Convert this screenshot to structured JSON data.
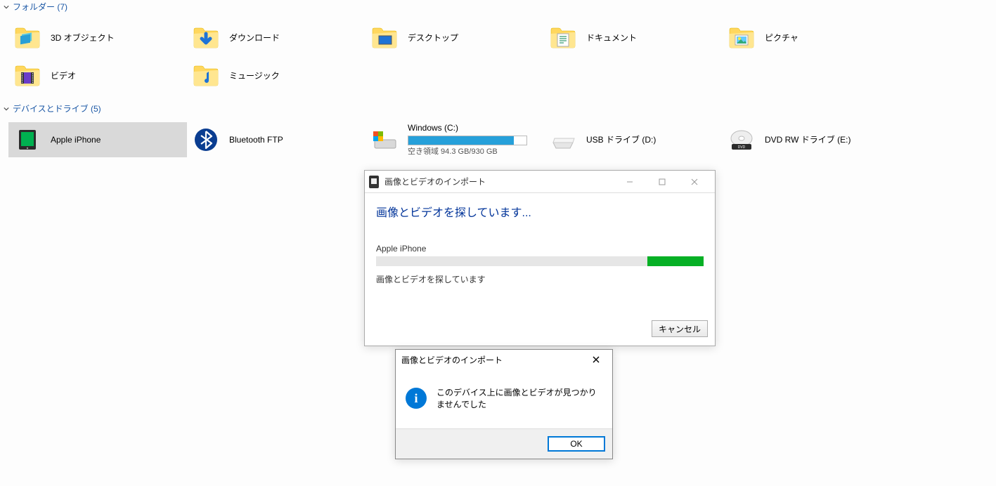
{
  "sections": {
    "folders": {
      "title": "フォルダー (7)",
      "items": [
        {
          "label": "3D オブジェクト",
          "icon": "3d"
        },
        {
          "label": "ダウンロード",
          "icon": "download"
        },
        {
          "label": "デスクトップ",
          "icon": "desktop"
        },
        {
          "label": "ドキュメント",
          "icon": "document"
        },
        {
          "label": "ピクチャ",
          "icon": "picture"
        },
        {
          "label": "ビデオ",
          "icon": "video"
        },
        {
          "label": "ミュージック",
          "icon": "music"
        }
      ]
    },
    "drives": {
      "title": "デバイスとドライブ (5)",
      "items": [
        {
          "label": "Apple iPhone",
          "icon": "phone",
          "selected": true
        },
        {
          "label": "Bluetooth FTP",
          "icon": "bluetooth"
        },
        {
          "label": "Windows (C:)",
          "icon": "windisk",
          "usage_text": "空き領域 94.3 GB/930 GB",
          "usage_pct": 89
        },
        {
          "label": "USB ドライブ (D:)",
          "icon": "usb"
        },
        {
          "label": "DVD RW ドライブ (E:)",
          "icon": "dvd"
        }
      ]
    }
  },
  "dialog_progress": {
    "title": "画像とビデオのインポート",
    "headline": "画像とビデオを探しています...",
    "device": "Apple iPhone",
    "status": "画像とビデオを探しています",
    "cancel": "キャンセル"
  },
  "dialog_message": {
    "title": "画像とビデオのインポート",
    "message": "このデバイス上に画像とビデオが見つかりませんでした",
    "ok": "OK"
  }
}
